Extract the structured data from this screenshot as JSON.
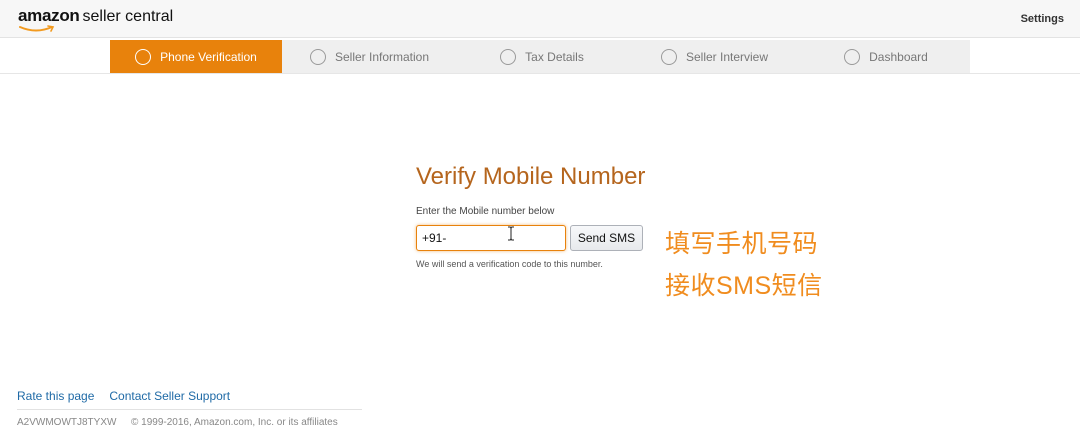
{
  "header": {
    "logo_amazon": "amazon",
    "logo_product": "seller central",
    "settings_label": "Settings"
  },
  "steps": [
    {
      "label": "Phone Verification",
      "active": true
    },
    {
      "label": "Seller Information",
      "active": false
    },
    {
      "label": "Tax Details",
      "active": false
    },
    {
      "label": "Seller Interview",
      "active": false
    },
    {
      "label": "Dashboard",
      "active": false
    }
  ],
  "form": {
    "title": "Verify Mobile Number",
    "label": "Enter the Mobile number below",
    "phone_value": "+91-",
    "send_button": "Send SMS",
    "hint": "We will send a verification code to this number."
  },
  "annotations": {
    "line1": "填写手机号码",
    "line2": "接收SMS短信"
  },
  "footer": {
    "rate_link": "Rate this page",
    "support_link": "Contact Seller Support",
    "merchant_id": "A2VWMOWTJ8TYXW",
    "copyright": "© 1999-2016, Amazon.com, Inc. or its affiliates"
  },
  "colors": {
    "accent_orange": "#e8820c",
    "title_brown": "#b5651d",
    "annotation_orange": "#f08c1e",
    "link_blue": "#1f6aa6"
  }
}
